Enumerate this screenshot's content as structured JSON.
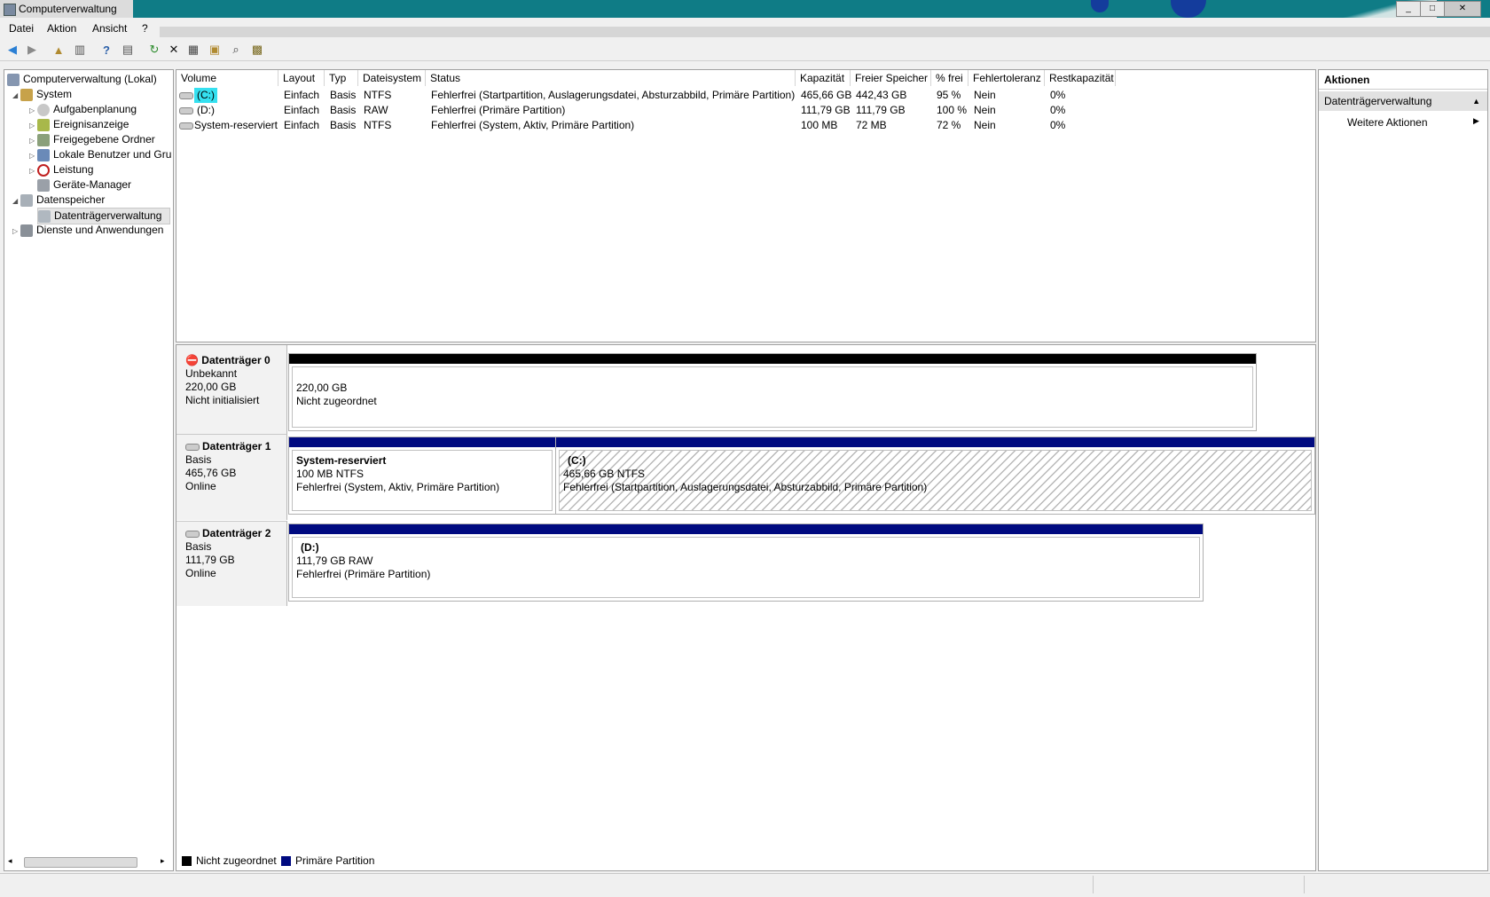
{
  "window": {
    "title": "Computerverwaltung",
    "min": "_",
    "max": "□",
    "close": "✕"
  },
  "menu": [
    "Datei",
    "Aktion",
    "Ansicht",
    "?"
  ],
  "tree": {
    "root": "Computerverwaltung (Lokal)",
    "system": "System",
    "system_items": [
      "Aufgabenplanung",
      "Ereignisanzeige",
      "Freigegebene Ordner",
      "Lokale Benutzer und Gru",
      "Leistung",
      "Geräte-Manager"
    ],
    "storage": "Datenspeicher",
    "storage_items": [
      "Datenträgerverwaltung"
    ],
    "services": "Dienste und Anwendungen"
  },
  "volume_list": {
    "columns": [
      "Volume",
      "Layout",
      "Typ",
      "Dateisystem",
      "Status",
      "Kapazität",
      "Freier Speicher",
      "% frei",
      "Fehlertoleranz",
      "Restkapazität"
    ],
    "rows": [
      [
        "(C:)",
        "Einfach",
        "Basis",
        "NTFS",
        "Fehlerfrei (Startpartition, Auslagerungsdatei, Absturzabbild, Primäre Partition)",
        "465,66 GB",
        "442,43 GB",
        "95 %",
        "Nein",
        "0%"
      ],
      [
        "(D:)",
        "Einfach",
        "Basis",
        "RAW",
        "Fehlerfrei (Primäre Partition)",
        "111,79 GB",
        "111,79 GB",
        "100 %",
        "Nein",
        "0%"
      ],
      [
        "System-reserviert",
        "Einfach",
        "Basis",
        "NTFS",
        "Fehlerfrei (System, Aktiv, Primäre Partition)",
        "100 MB",
        "72 MB",
        "72 %",
        "Nein",
        "0%"
      ]
    ]
  },
  "disks": [
    {
      "name": "Datenträger 0",
      "type": "Unbekannt",
      "size": "220,00 GB",
      "state": "Nicht initialisiert",
      "partitions": [
        {
          "name": "",
          "size": "220,00 GB",
          "status": "Nicht zugeordnet"
        }
      ]
    },
    {
      "name": "Datenträger 1",
      "type": "Basis",
      "size": "465,76 GB",
      "state": "Online",
      "partitions": [
        {
          "name": "System-reserviert",
          "size": "100 MB NTFS",
          "status": "Fehlerfrei (System, Aktiv, Primäre Partition)"
        },
        {
          "name": "(C:)",
          "size": "465,66 GB NTFS",
          "status": "Fehlerfrei (Startpartition, Auslagerungsdatei, Absturzabbild, Primäre Partition)"
        }
      ]
    },
    {
      "name": "Datenträger 2",
      "type": "Basis",
      "size": "111,79 GB",
      "state": "Online",
      "partitions": [
        {
          "name": "(D:)",
          "size": "111,79 GB RAW",
          "status": "Fehlerfrei (Primäre Partition)"
        }
      ]
    }
  ],
  "legend": [
    {
      "label": "Nicht zugeordnet",
      "color": "#000000"
    },
    {
      "label": "Primäre Partition",
      "color": "#000a80"
    }
  ],
  "actions": {
    "title": "Aktionen",
    "section": "Datenträgerverwaltung",
    "more": "Weitere Aktionen"
  },
  "colors": {
    "titlebar": "#0f7c86",
    "primary": "#000a80",
    "unallocated": "#000000",
    "selection": "#35e0f0"
  },
  "icons": [
    "back-arrow-icon",
    "forward-arrow-icon",
    "up-folder-icon",
    "show-hide-tree-icon",
    "help-icon",
    "show-hide-action-icon",
    "refresh-icon",
    "delete-icon",
    "properties-icon",
    "open-icon",
    "search-icon",
    "wizard-icon"
  ]
}
